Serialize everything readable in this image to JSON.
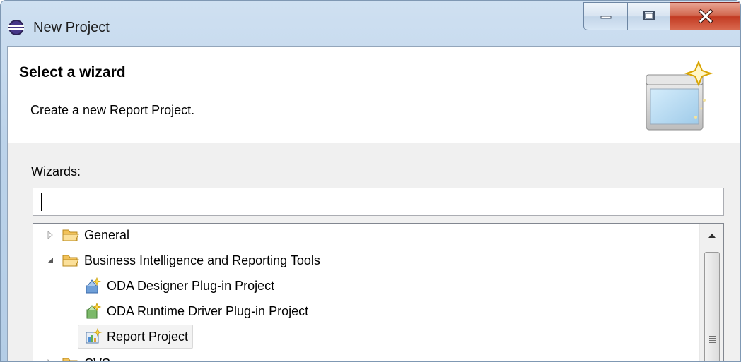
{
  "window": {
    "title": "New Project",
    "icon": "eclipse-icon",
    "controls": [
      "minimize-icon",
      "maximize-icon",
      "close-icon"
    ]
  },
  "header": {
    "title": "Select a wizard",
    "description": "Create a new Report Project.",
    "banner_icon": "new-wizard-banner-icon"
  },
  "body": {
    "wizards_label": "Wizards:",
    "filter_value": ""
  },
  "tree": {
    "items": [
      {
        "label": "General",
        "icon": "folder-icon",
        "expander": "collapsed"
      },
      {
        "label": "Business Intelligence and Reporting Tools",
        "icon": "folder-icon",
        "expander": "expanded"
      },
      {
        "label": "ODA Designer Plug-in Project",
        "icon": "plugin-project-icon"
      },
      {
        "label": "ODA Runtime Driver Plug-in Project",
        "icon": "plugin-project-icon"
      },
      {
        "label": "Report Project",
        "icon": "report-project-icon",
        "selected": true
      },
      {
        "label": "CVS",
        "icon": "folder-icon",
        "expander": "collapsed"
      }
    ]
  },
  "scrollbar": {
    "up_icon": "scroll-up-arrow-icon"
  }
}
